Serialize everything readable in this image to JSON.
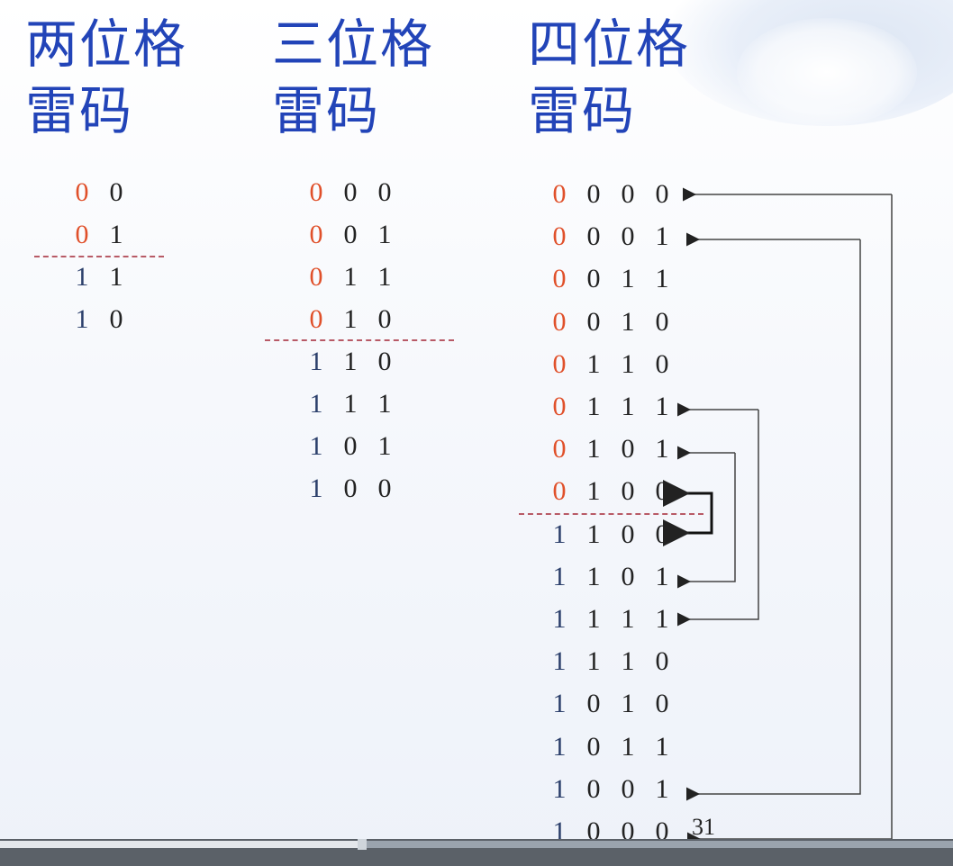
{
  "slide": {
    "col2": {
      "title_line1": "两位格",
      "title_line2": "雷码",
      "rows": [
        [
          "0",
          "0"
        ],
        [
          "0",
          "1"
        ],
        [
          "1",
          "1"
        ],
        [
          "1",
          "0"
        ]
      ]
    },
    "col3": {
      "title_line1": "三位格",
      "title_line2": "雷码",
      "rows": [
        [
          "0",
          "0",
          "0"
        ],
        [
          "0",
          "0",
          "1"
        ],
        [
          "0",
          "1",
          "1"
        ],
        [
          "0",
          "1",
          "0"
        ],
        [
          "1",
          "1",
          "0"
        ],
        [
          "1",
          "1",
          "1"
        ],
        [
          "1",
          "0",
          "1"
        ],
        [
          "1",
          "0",
          "0"
        ]
      ]
    },
    "col4": {
      "title_line1": "四位格",
      "title_line2": "雷码",
      "rows": [
        [
          "0",
          "0",
          "0",
          "0"
        ],
        [
          "0",
          "0",
          "0",
          "1"
        ],
        [
          "0",
          "0",
          "1",
          "1"
        ],
        [
          "0",
          "0",
          "1",
          "0"
        ],
        [
          "0",
          "1",
          "1",
          "0"
        ],
        [
          "0",
          "1",
          "1",
          "1"
        ],
        [
          "0",
          "1",
          "0",
          "1"
        ],
        [
          "0",
          "1",
          "0",
          "0"
        ],
        [
          "1",
          "1",
          "0",
          "0"
        ],
        [
          "1",
          "1",
          "0",
          "1"
        ],
        [
          "1",
          "1",
          "1",
          "1"
        ],
        [
          "1",
          "1",
          "1",
          "0"
        ],
        [
          "1",
          "0",
          "1",
          "0"
        ],
        [
          "1",
          "0",
          "1",
          "1"
        ],
        [
          "1",
          "0",
          "0",
          "1"
        ],
        [
          "1",
          "0",
          "0",
          "0"
        ]
      ]
    },
    "corner_label": "31"
  },
  "colors": {
    "title": "#2244b8",
    "prefix_zero": "#e0502a",
    "prefix_one": "#2b3f6b",
    "divider": "#b85a66"
  },
  "player": {
    "progress_fraction": 0.38
  }
}
